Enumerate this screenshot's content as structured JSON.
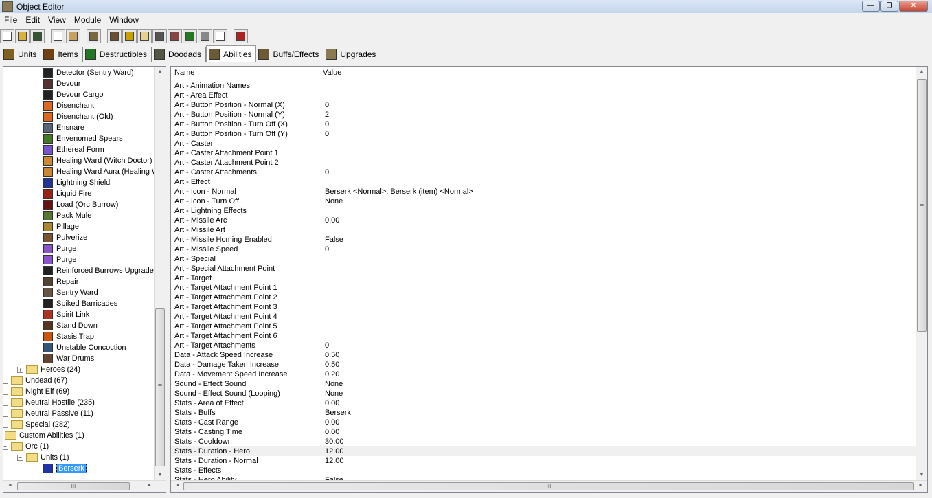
{
  "window": {
    "title": "Object Editor",
    "minimize": "—",
    "maximize": "❐",
    "close": "✕"
  },
  "menu": [
    "File",
    "Edit",
    "View",
    "Module",
    "Window"
  ],
  "toolbar": [
    {
      "icon": "new-icon",
      "color": "#ffffff"
    },
    {
      "icon": "open-icon",
      "color": "#d8b040"
    },
    {
      "icon": "save-icon",
      "color": "#335533"
    },
    {
      "gap": true
    },
    {
      "icon": "copy-icon",
      "color": "#ffffff"
    },
    {
      "icon": "paste-icon",
      "color": "#c8a060"
    },
    {
      "gap": true
    },
    {
      "icon": "abilities-icon",
      "color": "#7a6a40"
    },
    {
      "gap": true
    },
    {
      "icon": "terrain-icon",
      "color": "#6b5030"
    },
    {
      "icon": "text-icon",
      "color": "#c8a000"
    },
    {
      "icon": "sound-icon",
      "color": "#e8d090"
    },
    {
      "icon": "unit-icon",
      "color": "#555555"
    },
    {
      "icon": "doodad-icon",
      "color": "#884444"
    },
    {
      "icon": "script-icon",
      "color": "#227722"
    },
    {
      "icon": "object-icon",
      "color": "#888888"
    },
    {
      "icon": "import-icon",
      "color": "#ffffff"
    },
    {
      "gap": true
    },
    {
      "icon": "test-icon",
      "color": "#aa2222"
    }
  ],
  "tabs": [
    {
      "label": "Units",
      "color": "#806020"
    },
    {
      "label": "Items",
      "color": "#704010"
    },
    {
      "label": "Destructibles",
      "color": "#227722"
    },
    {
      "label": "Doodads",
      "color": "#555544"
    },
    {
      "label": "Abilities",
      "color": "#6b5a33",
      "active": true
    },
    {
      "label": "Buffs/Effects",
      "color": "#6b5a33"
    },
    {
      "label": "Upgrades",
      "color": "#8a7a50"
    }
  ],
  "tree": [
    {
      "label": "Detector (Sentry Ward)",
      "level": 3,
      "icon": "#222222"
    },
    {
      "label": "Devour",
      "level": 3,
      "icon": "#553333"
    },
    {
      "label": "Devour Cargo",
      "level": 3,
      "icon": "#222222"
    },
    {
      "label": "Disenchant",
      "level": 3,
      "icon": "#dd6622"
    },
    {
      "label": "Disenchant (Old)",
      "level": 3,
      "icon": "#dd6622"
    },
    {
      "label": "Ensnare",
      "level": 3,
      "icon": "#556677"
    },
    {
      "label": "Envenomed Spears",
      "level": 3,
      "icon": "#447722"
    },
    {
      "label": "Ethereal Form",
      "level": 3,
      "icon": "#7755cc"
    },
    {
      "label": "Healing Ward (Witch Doctor)",
      "level": 3,
      "icon": "#cc8833"
    },
    {
      "label": "Healing Ward Aura (Healing W",
      "level": 3,
      "icon": "#cc8833"
    },
    {
      "label": "Lightning Shield",
      "level": 3,
      "icon": "#223399"
    },
    {
      "label": "Liquid Fire",
      "level": 3,
      "icon": "#992211"
    },
    {
      "label": "Load (Orc Burrow)",
      "level": 3,
      "icon": "#661111"
    },
    {
      "label": "Pack Mule",
      "level": 3,
      "icon": "#557733"
    },
    {
      "label": "Pillage",
      "level": 3,
      "icon": "#aa8833"
    },
    {
      "label": "Pulverize",
      "level": 3,
      "icon": "#775533"
    },
    {
      "label": "Purge",
      "level": 3,
      "icon": "#8855cc"
    },
    {
      "label": "Purge",
      "level": 3,
      "icon": "#8855cc"
    },
    {
      "label": "Reinforced Burrows Upgrade",
      "level": 3,
      "icon": "#222222"
    },
    {
      "label": "Repair",
      "level": 3,
      "icon": "#554433"
    },
    {
      "label": "Sentry Ward",
      "level": 3,
      "icon": "#665544"
    },
    {
      "label": "Spiked Barricades",
      "level": 3,
      "icon": "#222222"
    },
    {
      "label": "Spirit Link",
      "level": 3,
      "icon": "#aa3322"
    },
    {
      "label": "Stand Down",
      "level": 3,
      "icon": "#553322"
    },
    {
      "label": "Stasis Trap",
      "level": 3,
      "icon": "#cc5511"
    },
    {
      "label": "Unstable Concoction",
      "level": 3,
      "icon": "#335577"
    },
    {
      "label": "War Drums",
      "level": 3,
      "icon": "#664433"
    },
    {
      "label": "Heroes (24)",
      "level": 2,
      "folder": true,
      "pm": "+"
    },
    {
      "label": "Undead (67)",
      "level": 1,
      "folder": true,
      "pm": "+"
    },
    {
      "label": "Night Elf (69)",
      "level": 1,
      "folder": true,
      "pm": "+"
    },
    {
      "label": "Neutral Hostile (235)",
      "level": 1,
      "folder": true,
      "pm": "+"
    },
    {
      "label": "Neutral Passive (11)",
      "level": 1,
      "folder": true,
      "pm": "+"
    },
    {
      "label": "Special (282)",
      "level": 1,
      "folder": true,
      "pm": "+"
    },
    {
      "label": "Custom Abilities (1)",
      "level": 0,
      "folder": true
    },
    {
      "label": "Orc (1)",
      "level": 1,
      "folder": true,
      "pm": "−"
    },
    {
      "label": "Units (1)",
      "level": 2,
      "folder": true,
      "pm": "−"
    },
    {
      "label": "Berserk",
      "level": 3,
      "icon": "#2233aa",
      "selected": true
    }
  ],
  "table": {
    "headers": [
      "Name",
      "Value"
    ],
    "rows": [
      [
        "Art - Animation Names",
        ""
      ],
      [
        "Art - Area Effect",
        ""
      ],
      [
        "Art - Button Position - Normal (X)",
        "0"
      ],
      [
        "Art - Button Position - Normal (Y)",
        "2"
      ],
      [
        "Art - Button Position - Turn Off (X)",
        "0"
      ],
      [
        "Art - Button Position - Turn Off (Y)",
        "0"
      ],
      [
        "Art - Caster",
        ""
      ],
      [
        "Art - Caster Attachment Point 1",
        ""
      ],
      [
        "Art - Caster Attachment Point 2",
        ""
      ],
      [
        "Art - Caster Attachments",
        "0"
      ],
      [
        "Art - Effect",
        ""
      ],
      [
        "Art - Icon - Normal",
        "Berserk <Normal>, Berserk (item) <Normal>"
      ],
      [
        "Art - Icon - Turn Off",
        "None"
      ],
      [
        "Art - Lightning Effects",
        ""
      ],
      [
        "Art - Missile Arc",
        "0.00"
      ],
      [
        "Art - Missile Art",
        ""
      ],
      [
        "Art - Missile Homing Enabled",
        "False"
      ],
      [
        "Art - Missile Speed",
        "0"
      ],
      [
        "Art - Special",
        ""
      ],
      [
        "Art - Special Attachment Point",
        ""
      ],
      [
        "Art - Target",
        ""
      ],
      [
        "Art - Target Attachment Point 1",
        ""
      ],
      [
        "Art - Target Attachment Point 2",
        ""
      ],
      [
        "Art - Target Attachment Point 3",
        ""
      ],
      [
        "Art - Target Attachment Point 4",
        ""
      ],
      [
        "Art - Target Attachment Point 5",
        ""
      ],
      [
        "Art - Target Attachment Point 6",
        ""
      ],
      [
        "Art - Target Attachments",
        "0"
      ],
      [
        "Data - Attack Speed Increase",
        "0.50"
      ],
      [
        "Data - Damage Taken Increase",
        "0.50"
      ],
      [
        "Data - Movement Speed Increase",
        "0.20"
      ],
      [
        "Sound - Effect Sound",
        "None"
      ],
      [
        "Sound - Effect Sound (Looping)",
        "None"
      ],
      [
        "Stats - Area of Effect",
        "0.00"
      ],
      [
        "Stats - Buffs",
        "Berserk"
      ],
      [
        "Stats - Cast Range",
        "0.00"
      ],
      [
        "Stats - Casting Time",
        "0.00"
      ],
      [
        "Stats - Cooldown",
        "30.00"
      ],
      [
        "Stats - Duration - Hero",
        "12.00"
      ],
      [
        "Stats - Duration - Normal",
        "12.00"
      ],
      [
        "Stats - Effects",
        ""
      ],
      [
        "Stats - Hero Ability",
        "False"
      ]
    ],
    "highlighted_row": 38
  },
  "scroll": {
    "tree_thumb_glyph": "≡",
    "h_thumb_glyph": "III",
    "up": "▲",
    "down": "▼",
    "left": "◄",
    "right": "►"
  }
}
